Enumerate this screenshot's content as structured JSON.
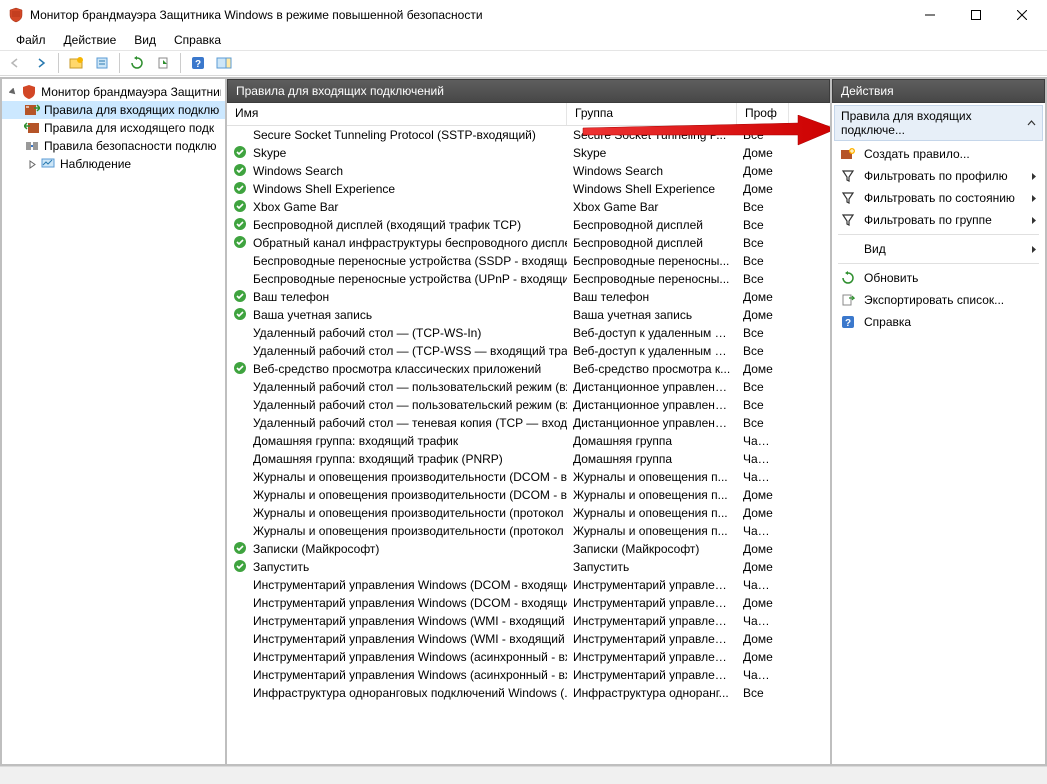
{
  "window": {
    "title": "Монитор брандмауэра Защитника Windows в режиме повышенной безопасности"
  },
  "menu": {
    "file": "Файл",
    "action": "Действие",
    "view": "Вид",
    "help": "Справка"
  },
  "tree": {
    "root": "Монитор брандмауэра Защитника",
    "items": [
      "Правила для входящих подклю",
      "Правила для исходящего подк",
      "Правила безопасности подклю",
      "Наблюдение"
    ]
  },
  "list": {
    "header": "Правила для входящих подключений",
    "columns": {
      "name": "Имя",
      "group": "Группа",
      "profile": "Проф"
    },
    "rows": [
      {
        "name": "Secure Socket Tunneling Protocol (SSTP-входящий)",
        "group": "Secure Socket Tunneling P...",
        "profile": "Все",
        "enabled": null
      },
      {
        "name": "Skype",
        "group": "Skype",
        "profile": "Доме",
        "enabled": true
      },
      {
        "name": "Windows Search",
        "group": "Windows Search",
        "profile": "Доме",
        "enabled": true
      },
      {
        "name": "Windows Shell Experience",
        "group": "Windows Shell Experience",
        "profile": "Доме",
        "enabled": true
      },
      {
        "name": "Xbox Game Bar",
        "group": "Xbox Game Bar",
        "profile": "Все",
        "enabled": true
      },
      {
        "name": "Беспроводной дисплей (входящий трафик TCP)",
        "group": "Беспроводной дисплей",
        "profile": "Все",
        "enabled": true
      },
      {
        "name": "Обратный канал инфраструктуры беспроводного дисплея...",
        "group": "Беспроводной дисплей",
        "profile": "Все",
        "enabled": true
      },
      {
        "name": "Беспроводные переносные устройства (SSDP - входящий)",
        "group": "Беспроводные переносны...",
        "profile": "Все",
        "enabled": null
      },
      {
        "name": "Беспроводные переносные устройства (UPnP - входящий)",
        "group": "Беспроводные переносны...",
        "profile": "Все",
        "enabled": null
      },
      {
        "name": "Ваш телефон",
        "group": "Ваш телефон",
        "profile": "Доме",
        "enabled": true
      },
      {
        "name": "Ваша учетная запись",
        "group": "Ваша учетная запись",
        "profile": "Доме",
        "enabled": true
      },
      {
        "name": "Удаленный рабочий стол — (TCP-WS-In)",
        "group": "Веб-доступ к удаленным р...",
        "profile": "Все",
        "enabled": null
      },
      {
        "name": "Удаленный рабочий стол — (TCP-WSS — входящий трафик)",
        "group": "Веб-доступ к удаленным р...",
        "profile": "Все",
        "enabled": null
      },
      {
        "name": "Веб-средство просмотра классических приложений",
        "group": "Веб-средство просмотра к...",
        "profile": "Доме",
        "enabled": true
      },
      {
        "name": "Удаленный рабочий стол — пользовательский режим (вх...",
        "group": "Дистанционное управлени...",
        "profile": "Все",
        "enabled": null
      },
      {
        "name": "Удаленный рабочий стол — пользовательский режим (вх...",
        "group": "Дистанционное управлени...",
        "profile": "Все",
        "enabled": null
      },
      {
        "name": "Удаленный рабочий стол — теневая копия (TCP — входящ...",
        "group": "Дистанционное управлени...",
        "profile": "Все",
        "enabled": null
      },
      {
        "name": "Домашняя группа: входящий трафик",
        "group": "Домашняя группа",
        "profile": "Частн",
        "enabled": null
      },
      {
        "name": "Домашняя группа: входящий трафик (PNRP)",
        "group": "Домашняя группа",
        "profile": "Частн",
        "enabled": null
      },
      {
        "name": "Журналы и оповещения производительности (DCOM - вх...",
        "group": "Журналы и оповещения п...",
        "profile": "Частн",
        "enabled": null
      },
      {
        "name": "Журналы и оповещения производительности (DCOM - вх...",
        "group": "Журналы и оповещения п...",
        "profile": "Доме",
        "enabled": null
      },
      {
        "name": "Журналы и оповещения производительности (протокол T...",
        "group": "Журналы и оповещения п...",
        "profile": "Доме",
        "enabled": null
      },
      {
        "name": "Журналы и оповещения производительности (протокол T...",
        "group": "Журналы и оповещения п...",
        "profile": "Частн",
        "enabled": null
      },
      {
        "name": "Записки (Майкрософт)",
        "group": "Записки (Майкрософт)",
        "profile": "Доме",
        "enabled": true
      },
      {
        "name": "Запустить",
        "group": "Запустить",
        "profile": "Доме",
        "enabled": true
      },
      {
        "name": "Инструментарий управления Windows (DCOM - входящий...",
        "group": "Инструментарий управлен...",
        "profile": "Частн",
        "enabled": null
      },
      {
        "name": "Инструментарий управления Windows (DCOM - входящий...",
        "group": "Инструментарий управлен...",
        "profile": "Доме",
        "enabled": null
      },
      {
        "name": "Инструментарий управления Windows (WMI - входящий т...",
        "group": "Инструментарий управлен...",
        "profile": "Частн",
        "enabled": null
      },
      {
        "name": "Инструментарий управления Windows (WMI - входящий т...",
        "group": "Инструментарий управлен...",
        "profile": "Доме",
        "enabled": null
      },
      {
        "name": "Инструментарий управления Windows (асинхронный - вх...",
        "group": "Инструментарий управлен...",
        "profile": "Доме",
        "enabled": null
      },
      {
        "name": "Инструментарий управления Windows (асинхронный - вх...",
        "group": "Инструментарий управлен...",
        "profile": "Частн",
        "enabled": null
      },
      {
        "name": "Инфраструктура одноранговых подключений Windows (...",
        "group": "Инфраструктура одноранг...",
        "profile": "Все",
        "enabled": null
      }
    ]
  },
  "actions": {
    "header": "Действия",
    "section": "Правила для входящих подключе...",
    "items": {
      "new_rule": "Создать правило...",
      "filter_profile": "Фильтровать по профилю",
      "filter_state": "Фильтровать по состоянию",
      "filter_group": "Фильтровать по группе",
      "view": "Вид",
      "refresh": "Обновить",
      "export": "Экспортировать список...",
      "help": "Справка"
    }
  }
}
